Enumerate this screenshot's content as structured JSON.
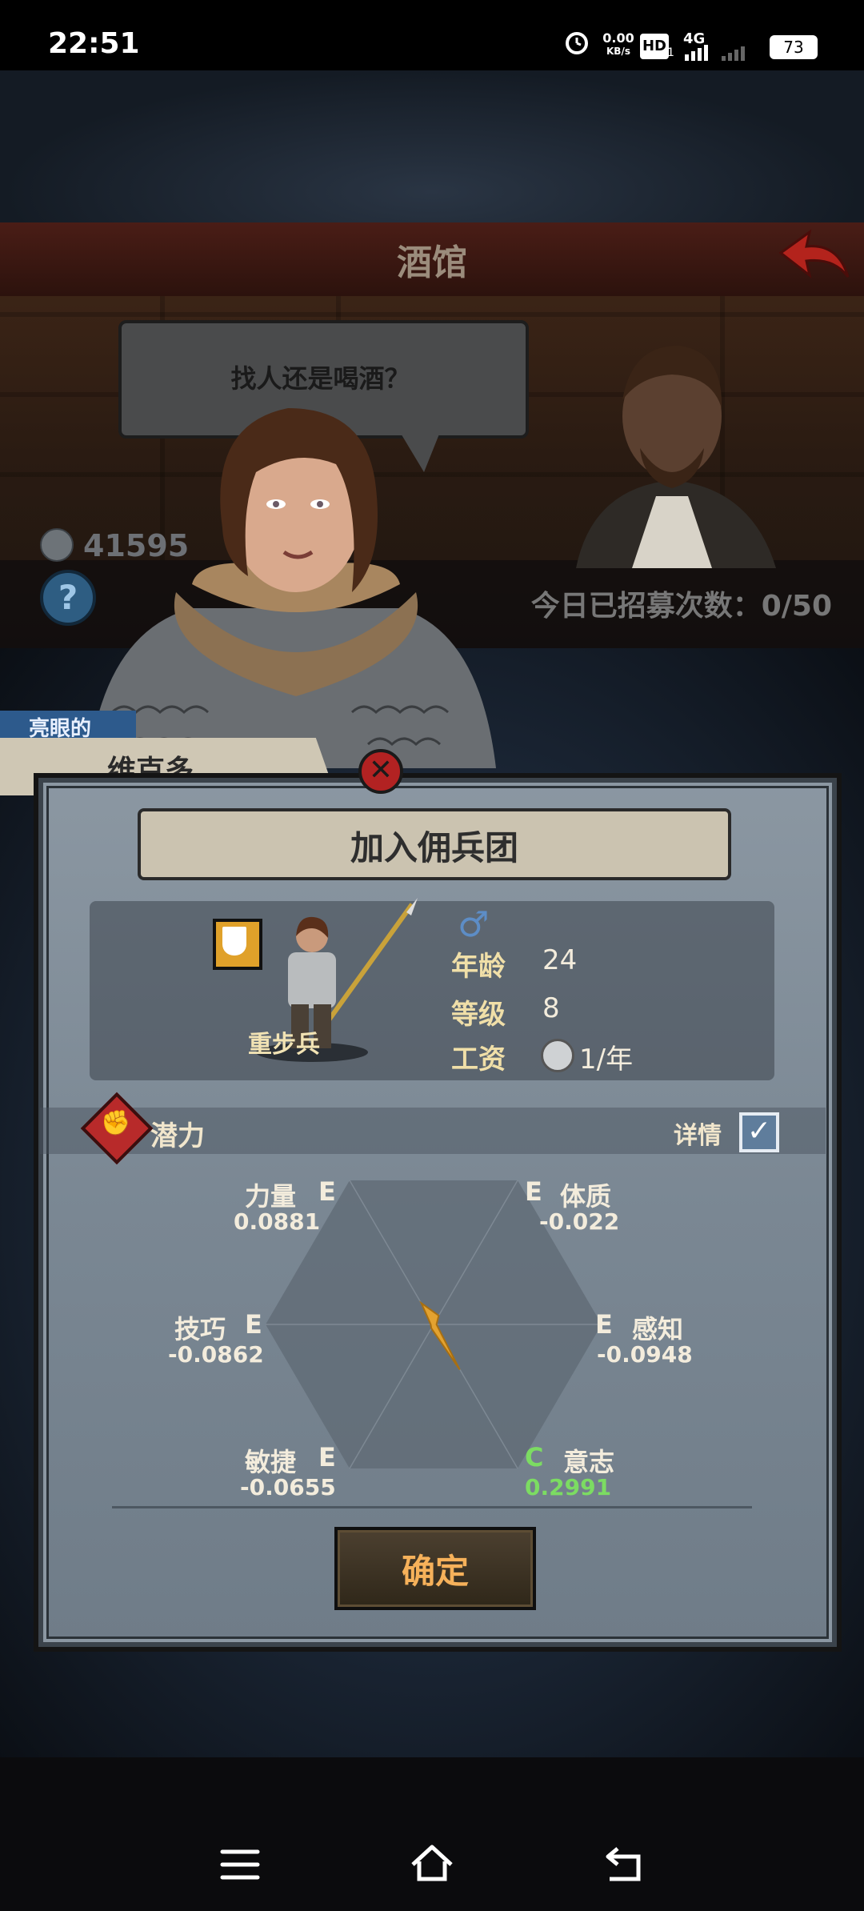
{
  "status_bar": {
    "time": "22:51",
    "net_speed": "0.00",
    "net_unit": "KB/s",
    "hd": "HD",
    "sim": "1",
    "network": "4G",
    "battery": "73"
  },
  "header": {
    "title": "酒馆"
  },
  "tavern": {
    "speech": "找人还是喝酒？",
    "coins": "41595",
    "help_label": "?",
    "recruit_count": "今日已招募次数：0/50"
  },
  "recruit": {
    "trait": "亮眼的",
    "name": "维克多",
    "close_label": "✕"
  },
  "dialog": {
    "title": "加入佣兵团",
    "class_name": "重步兵",
    "gender_symbol": "♂",
    "stats": [
      {
        "label": "年龄",
        "value": "24"
      },
      {
        "label": "等级",
        "value": "8"
      },
      {
        "label": "工资",
        "value": "1/年"
      }
    ],
    "potential_label": "潜力",
    "detail_label": "详情",
    "detail_checked": "✓",
    "attributes": {
      "strength": {
        "name": "力量",
        "grade": "E",
        "value": "0.0881"
      },
      "constitution": {
        "name": "体质",
        "grade": "E",
        "value": "-0.022"
      },
      "skill": {
        "name": "技巧",
        "grade": "E",
        "value": "-0.0862"
      },
      "perception": {
        "name": "感知",
        "grade": "E",
        "value": "-0.0948"
      },
      "agility": {
        "name": "敏捷",
        "grade": "E",
        "value": "-0.0655"
      },
      "willpower": {
        "name": "意志",
        "grade": "C",
        "value": "0.2991"
      }
    },
    "confirm_label": "确定"
  },
  "colors": {
    "accent_gold": "#f6b15a",
    "grade_c": "#7cdc62",
    "radar_fill": "#e3a230"
  }
}
